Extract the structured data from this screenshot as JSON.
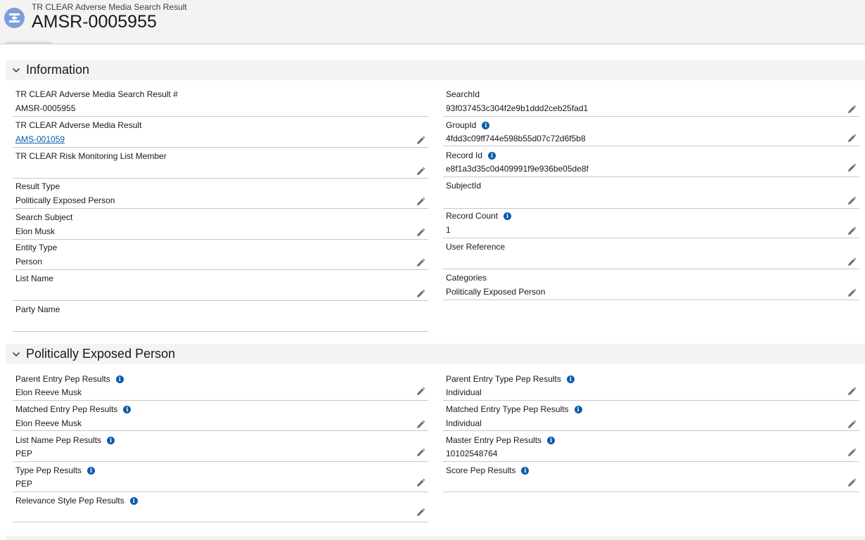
{
  "header": {
    "object_label": "TR CLEAR Adverse Media Search Result",
    "record_name": "AMSR-0005955"
  },
  "sections": {
    "information": {
      "title": "Information"
    },
    "pep": {
      "title": "Politically Exposed Person"
    }
  },
  "info": {
    "left": [
      {
        "label": "TR CLEAR Adverse Media Search Result #",
        "value": "AMSR-0005955"
      },
      {
        "label": "TR CLEAR Adverse Media Result",
        "value": "AMS-001059"
      },
      {
        "label": "TR CLEAR Risk Monitoring List Member",
        "value": ""
      },
      {
        "label": "Result Type",
        "value": "Politically Exposed Person"
      },
      {
        "label": "Search Subject",
        "value": "Elon Musk"
      },
      {
        "label": "Entity Type",
        "value": "Person"
      },
      {
        "label": "List Name",
        "value": ""
      },
      {
        "label": "Party Name",
        "value": ""
      }
    ],
    "right": [
      {
        "label": "SearchId",
        "value": "93f037453c304f2e9b1ddd2ceb25fad1"
      },
      {
        "label": "GroupId",
        "value": "4fdd3c09ff744e598b55d07c72d6f5b8"
      },
      {
        "label": "Record Id",
        "value": "e8f1a3d35c0d409991f9e936be05de8f"
      },
      {
        "label": "SubjectId",
        "value": ""
      },
      {
        "label": "Record Count",
        "value": "1"
      },
      {
        "label": "User Reference",
        "value": ""
      },
      {
        "label": "Categories",
        "value": "Politically Exposed Person"
      }
    ]
  },
  "pep": {
    "left": [
      {
        "label": "Parent Entry Pep Results",
        "value": "Elon Reeve Musk"
      },
      {
        "label": "Matched Entry Pep Results",
        "value": "Elon Reeve Musk"
      },
      {
        "label": "List Name Pep Results",
        "value": "PEP"
      },
      {
        "label": "Type Pep Results",
        "value": "PEP"
      },
      {
        "label": "Relevance Style Pep Results",
        "value": ""
      }
    ],
    "right": [
      {
        "label": "Parent Entry Type Pep Results",
        "value": "Individual"
      },
      {
        "label": "Matched Entry Type Pep Results",
        "value": "Individual"
      },
      {
        "label": "Master Entry Pep Results",
        "value": "10102548764"
      },
      {
        "label": "Score Pep Results",
        "value": ""
      }
    ]
  },
  "icons": {
    "record_icon": "record-icon",
    "edit": "pencil-icon",
    "help": "info-icon",
    "collapse": "chevron-down-icon"
  },
  "colors": {
    "link": "#0b5cab",
    "info_icon": "#0b5cab",
    "record_icon_bg": "#7d9fd9",
    "section_bg": "#f3f3f3"
  }
}
